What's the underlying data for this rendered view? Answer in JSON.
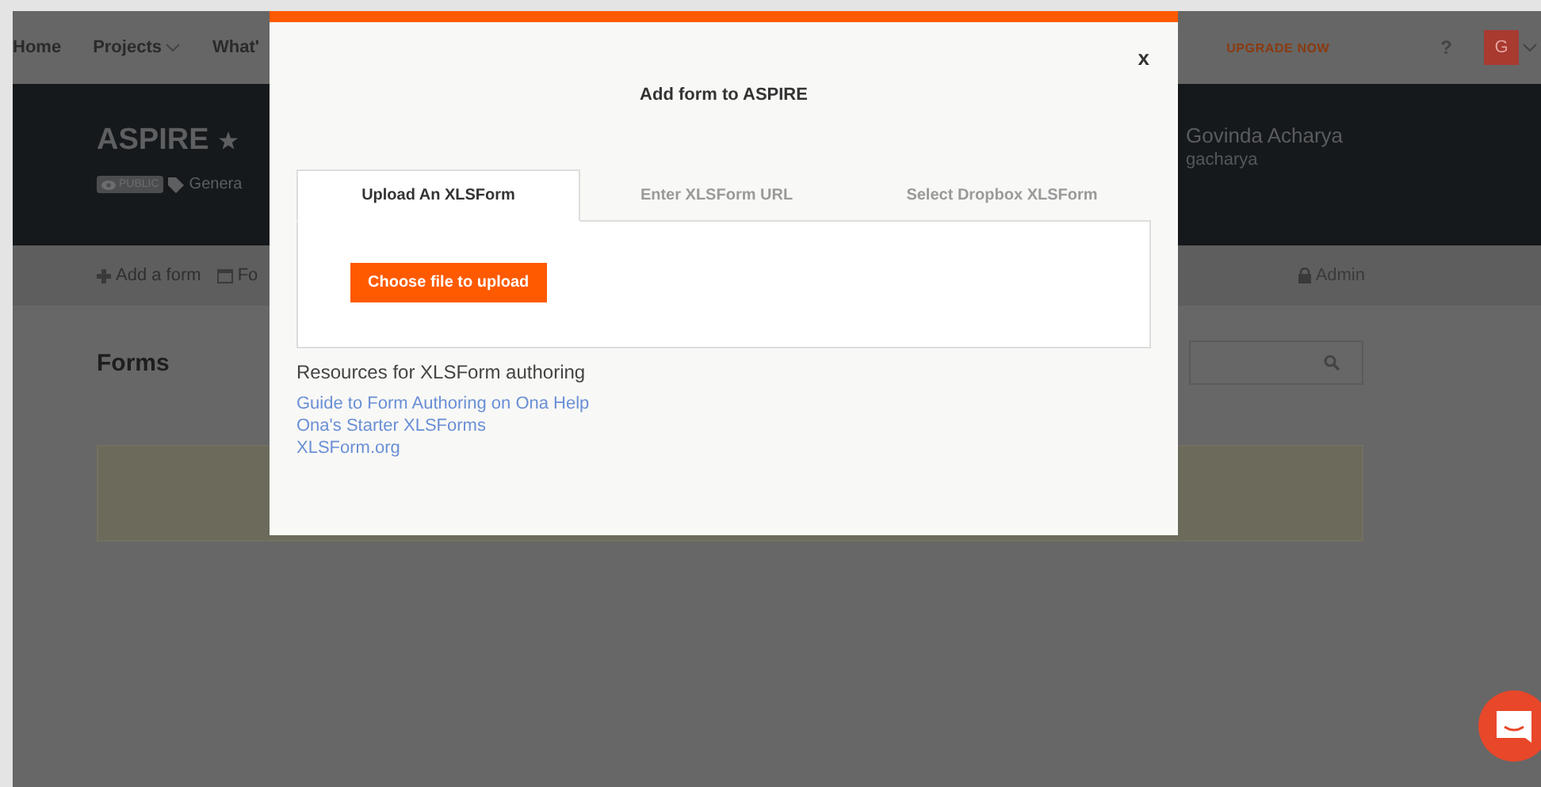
{
  "nav": {
    "items": [
      {
        "label": "Home",
        "dropdown": false
      },
      {
        "label": "Projects",
        "dropdown": true
      },
      {
        "label": "What'",
        "dropdown": false
      }
    ],
    "upgrade": "UPGRADE NOW",
    "help": "?",
    "avatar": "G"
  },
  "project": {
    "name": "ASPIRE",
    "starred": true,
    "visibility": "PUBLIC",
    "tag": "Genera",
    "owner_name": "Govinda Acharya",
    "owner_username": "gacharya"
  },
  "subnav": {
    "actions": [
      {
        "label": "Add a form",
        "kind": "plus"
      },
      {
        "label": "Fo",
        "kind": "form"
      }
    ],
    "admin": "Admin"
  },
  "forms": {
    "heading": "Forms"
  },
  "modal": {
    "title": "Add form to ASPIRE",
    "close": "x",
    "tabs": [
      {
        "label": "Upload An XLSForm",
        "selected": true
      },
      {
        "label": "Enter XLSForm URL",
        "selected": false
      },
      {
        "label": "Select Dropbox XLSForm",
        "selected": false
      }
    ],
    "upload_button": "Choose file to upload",
    "resources_heading": "Resources for XLSForm authoring",
    "links": [
      "Guide to Form Authoring on Ona Help",
      "Ona's Starter XLSForms",
      "XLSForm.org"
    ]
  }
}
